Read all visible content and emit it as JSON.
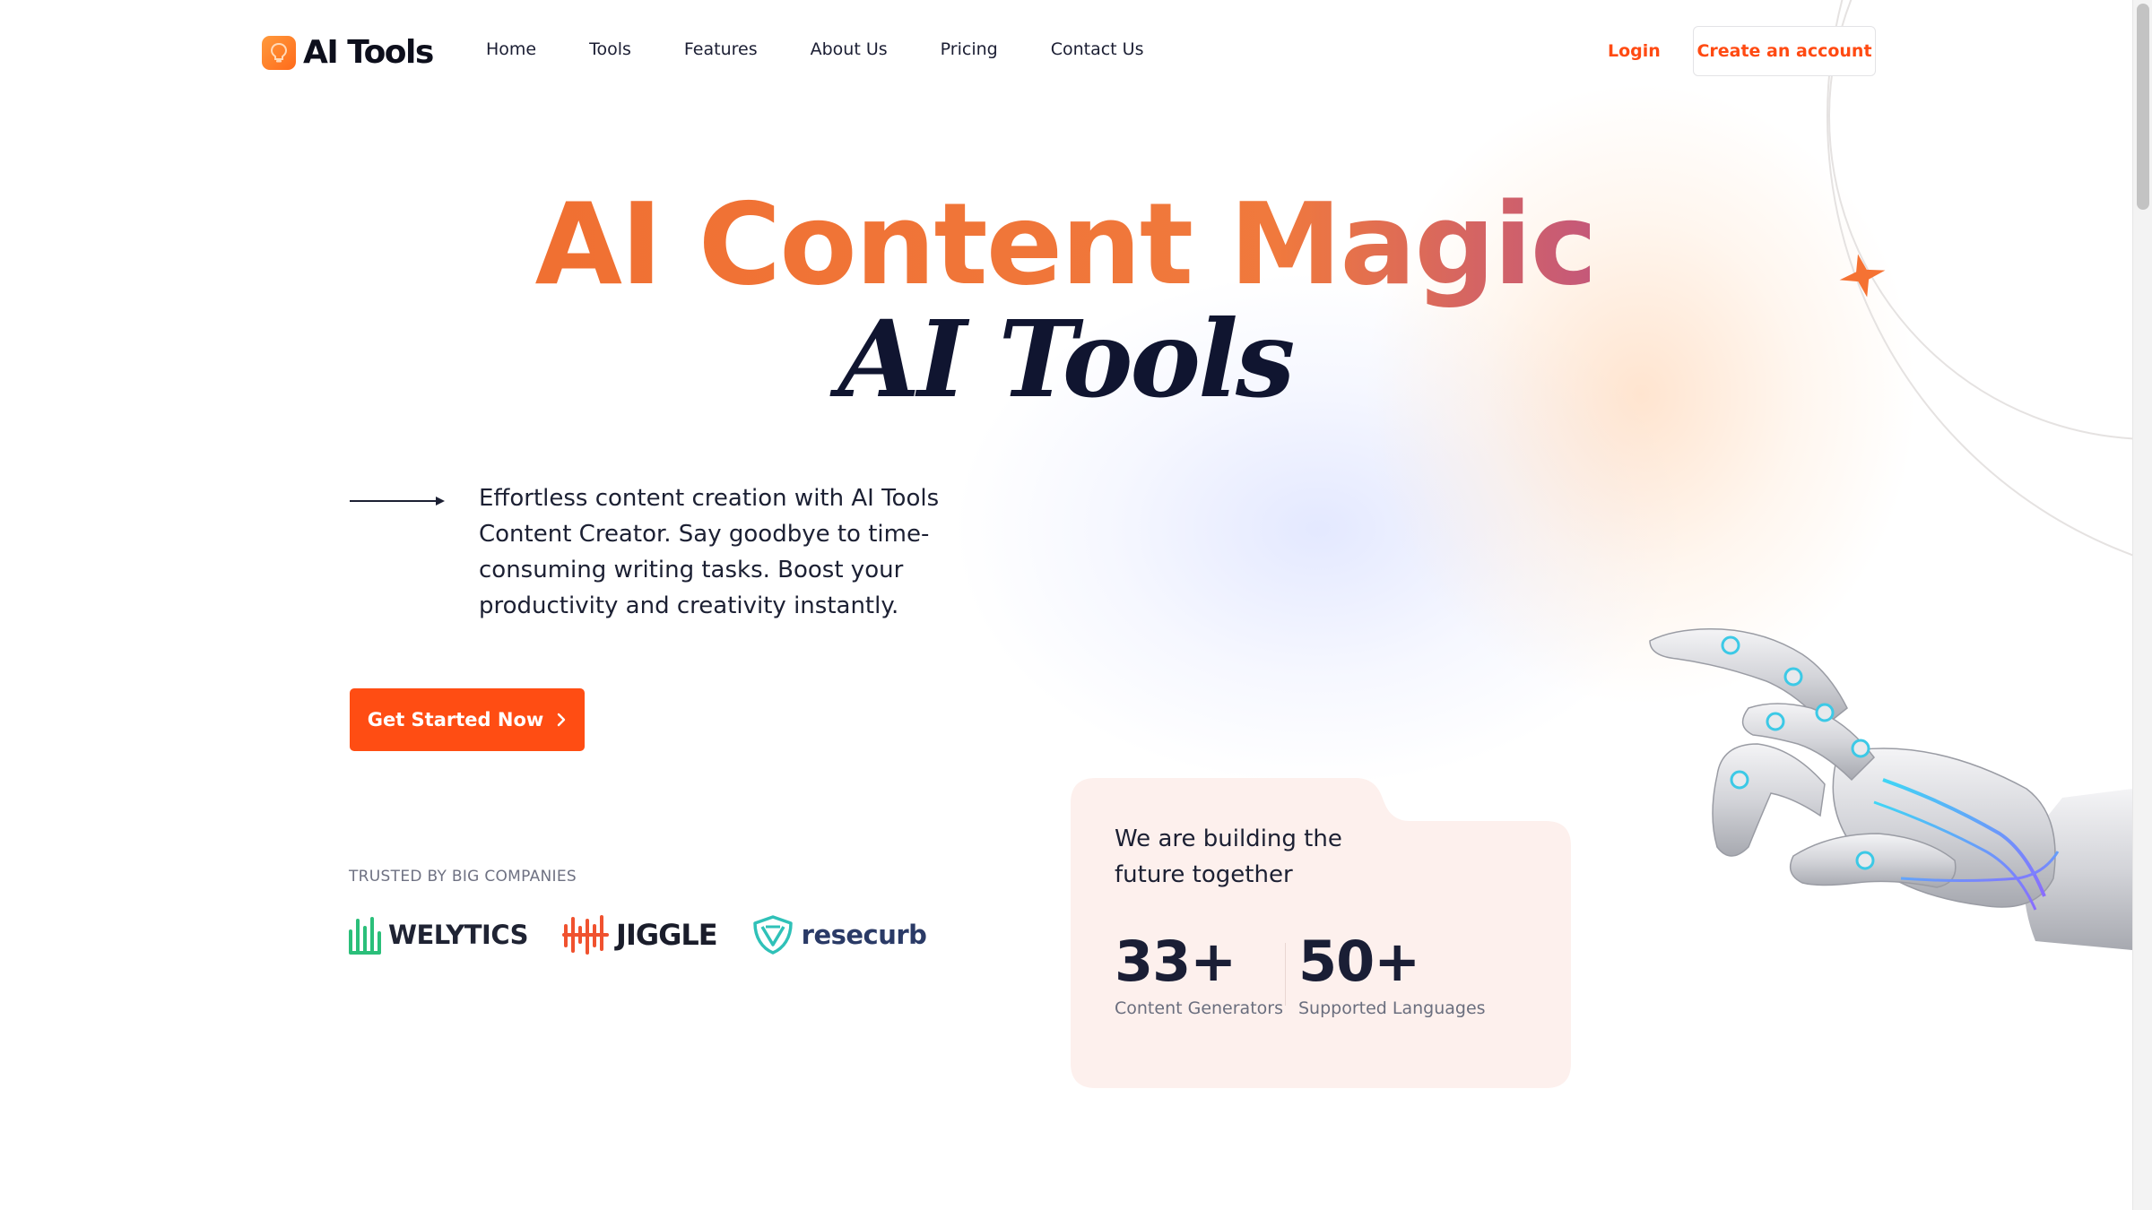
{
  "header": {
    "logo_text": "AI Tools",
    "nav": [
      "Home",
      "Tools",
      "Features",
      "About Us",
      "Pricing",
      "Contact Us"
    ],
    "login_label": "Login",
    "create_account_label": "Create an account"
  },
  "hero": {
    "title": "AI Content Magic",
    "subtitle": "AI Tools",
    "description": "Effortless content creation with AI Tools Content Creator. Say goodbye to time-consuming writing tasks. Boost your productivity and creativity instantly.",
    "cta_label": "Get Started Now"
  },
  "trusted": {
    "label": "TRUSTED BY BIG COMPANIES",
    "brands": [
      "WELYTICS",
      "JIGGLE",
      "resecurb"
    ]
  },
  "stats_card": {
    "title": "We are building the future together",
    "stats": [
      {
        "value": "33+",
        "label": "Content Generators"
      },
      {
        "value": "50+",
        "label": "Supported Languages"
      }
    ]
  },
  "colors": {
    "accent": "#ff4d13",
    "title_gradient_start": "#f07032",
    "title_gradient_end": "#c4587a",
    "card_bg": "#fdf0ed",
    "dark_text": "#141a33"
  },
  "icons": [
    "logo-mark-icon",
    "arrow-right-line-icon",
    "chevron-right-icon",
    "welytics-logo-icon",
    "jiggle-logo-icon",
    "resecurb-shield-icon",
    "sparkle-star-icon",
    "robot-hand-image"
  ]
}
